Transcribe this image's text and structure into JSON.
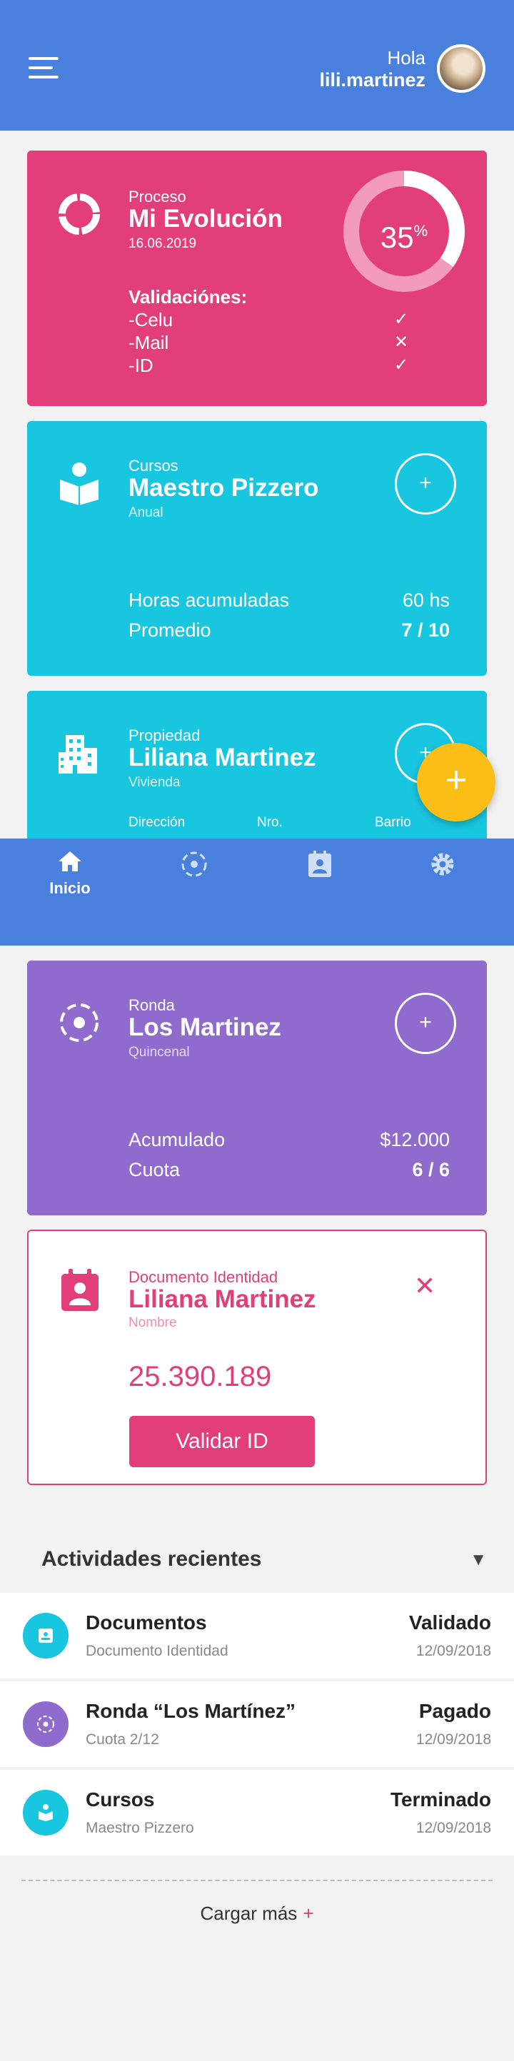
{
  "header": {
    "greeting": "Hola",
    "username": "lili.martinez"
  },
  "proceso": {
    "category": "Proceso",
    "title": "Mi Evolución",
    "date": "16.06.2019",
    "progress_value": "35",
    "progress_unit": "%",
    "progress_fraction": 0.35,
    "validations_label": "Validaciónes:",
    "validations": [
      {
        "label": "-Celu",
        "mark": "✓"
      },
      {
        "label": "-Mail",
        "mark": "✕"
      },
      {
        "label": "-ID",
        "mark": "✓"
      }
    ]
  },
  "cursos": {
    "category": "Cursos",
    "title": "Maestro Pizzero",
    "subtitle": "Anual",
    "add_label": "+",
    "rows": [
      {
        "label": "Horas acumuladas",
        "value": "60 hs"
      },
      {
        "label": "Promedio",
        "value": "7 / 10"
      }
    ]
  },
  "propiedad": {
    "category": "Propiedad",
    "title": "Liliana Martinez",
    "subtitle": "Vivienda",
    "add_label": "+",
    "fields": [
      "Dirección",
      "Nro.",
      "Barrio"
    ]
  },
  "fab": {
    "label": "+"
  },
  "bottom_nav": {
    "items": [
      {
        "label": "Inicio"
      }
    ]
  },
  "ronda": {
    "category": "Ronda",
    "title": "Los Martinez",
    "subtitle": "Quincenal",
    "add_label": "+",
    "rows": [
      {
        "label": "Acumulado",
        "value": "$12.000"
      },
      {
        "label": "Cuota",
        "value": "6 / 6"
      }
    ]
  },
  "documento": {
    "category": "Documento Identidad",
    "title": "Liliana Martinez",
    "subtitle": "Nombre",
    "number": "25.390.189",
    "button": "Validar ID",
    "close": "✕"
  },
  "actividades": {
    "title": "Actividades recientes",
    "toggle": "▼",
    "items": [
      {
        "name": "Documentos",
        "desc": "Documento Identidad",
        "status": "Validado",
        "date": "12/09/2018",
        "color": "#18c6e0"
      },
      {
        "name": "Ronda “Los Martínez”",
        "desc": "Cuota 2/12",
        "status": "Pagado",
        "date": "12/09/2018",
        "color": "#8e6bcc"
      },
      {
        "name": "Cursos",
        "desc": "Maestro Pizzero",
        "status": "Terminado",
        "date": "12/09/2018",
        "color": "#18c6e0"
      }
    ],
    "load_more": "Cargar más",
    "load_more_icon": "+"
  },
  "colors": {
    "header": "#4a80dd",
    "pink": "#e23e79",
    "cyan": "#18c6e0",
    "purple": "#8e6bcc",
    "fab": "#fbbe17"
  }
}
